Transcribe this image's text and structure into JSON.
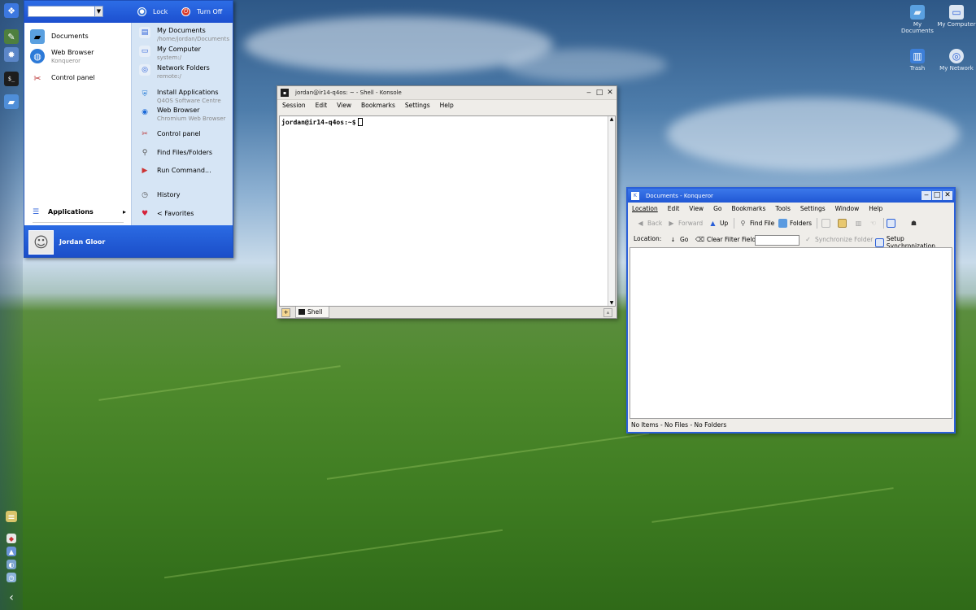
{
  "desktop": {
    "icons": [
      {
        "label": "My Documents",
        "icon": "documents-icon"
      },
      {
        "label": "My Computer",
        "icon": "computer-icon"
      },
      {
        "label": "Trash",
        "icon": "trash-icon"
      },
      {
        "label": "My Network",
        "icon": "network-icon"
      }
    ]
  },
  "start_menu": {
    "search_value": "",
    "lock_label": "Lock",
    "turnoff_label": "Turn Off",
    "left_items": [
      {
        "label": "Documents"
      },
      {
        "label": "Web Browser",
        "sub": "Konqueror"
      },
      {
        "label": "Control panel"
      }
    ],
    "applications_label": "Applications",
    "applications_arrow": "▸",
    "right_items": [
      {
        "label": "My Documents",
        "sub": "/home/jordan/Documents"
      },
      {
        "label": "My Computer",
        "sub": "system:/"
      },
      {
        "label": "Network Folders",
        "sub": "remote:/"
      },
      {
        "label": "Install Applications",
        "sub": "Q4OS Software Centre"
      },
      {
        "label": "Web Browser",
        "sub": "Chromium Web Browser"
      },
      {
        "label": "Control panel"
      },
      {
        "label": "Find Files/Folders"
      },
      {
        "label": "Run Command..."
      },
      {
        "label": "History"
      },
      {
        "label": "< Favorites"
      }
    ],
    "user_name": "Jordan Gloor"
  },
  "konsole": {
    "title": "jordan@ir14-q4os: ~ - Shell - Konsole",
    "menu": [
      "Session",
      "Edit",
      "View",
      "Bookmarks",
      "Settings",
      "Help"
    ],
    "prompt": "jordan@ir14-q4os:~$",
    "tab_label": "Shell"
  },
  "konqueror": {
    "title": "Documents - Konqueror",
    "menu": [
      "Location",
      "Edit",
      "View",
      "Go",
      "Bookmarks",
      "Tools",
      "Settings",
      "Window",
      "Help"
    ],
    "toolbar": {
      "back": "Back",
      "forward": "Forward",
      "up": "Up",
      "find_file": "Find File",
      "folders": "Folders"
    },
    "location_label": "Location:",
    "go_label": "Go",
    "clear_filter_label": "Clear Filter Field",
    "filter_value": "",
    "sync_folder_label": "Synchronize Folder",
    "setup_sync_label": "Setup Synchronization",
    "status": "No Items - No Files - No Folders"
  },
  "colors": {
    "accent": "#1c4fcf",
    "konqueror_title": "#2a5fd8",
    "sm_right_bg": "#d6e5f5"
  }
}
